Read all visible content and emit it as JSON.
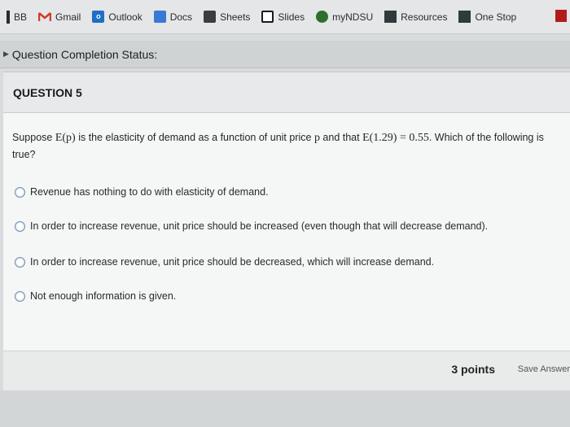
{
  "bookmarks": [
    {
      "label": "BB",
      "icon": "blackboard-icon"
    },
    {
      "label": "Gmail",
      "icon": "gmail-icon"
    },
    {
      "label": "Outlook",
      "icon": "outlook-icon"
    },
    {
      "label": "Docs",
      "icon": "docs-icon"
    },
    {
      "label": "Sheets",
      "icon": "sheets-icon"
    },
    {
      "label": "Slides",
      "icon": "slides-icon"
    },
    {
      "label": "myNDSU",
      "icon": "myndsu-icon"
    },
    {
      "label": "Resources",
      "icon": "resources-icon"
    },
    {
      "label": "One Stop",
      "icon": "onestop-icon"
    }
  ],
  "status": {
    "label": "Question Completion Status:"
  },
  "question": {
    "header": "QUESTION 5",
    "text_prefix": "Suppose ",
    "math1": "E(p)",
    "text_mid": " is the elasticity of demand as a function of unit price ",
    "math2": "p",
    "text_mid2": " and that ",
    "math3": "E(1.29) = 0.55",
    "text_suffix": ". Which of the following is true?",
    "options": [
      "Revenue has nothing to do with elasticity of demand.",
      "In order to increase revenue, unit price should be increased (even though that will decrease demand).",
      "In order to increase revenue, unit price should be decreased, which will increase demand.",
      "Not enough information is given."
    ],
    "points": "3 points",
    "save_label": "Save Answer"
  }
}
